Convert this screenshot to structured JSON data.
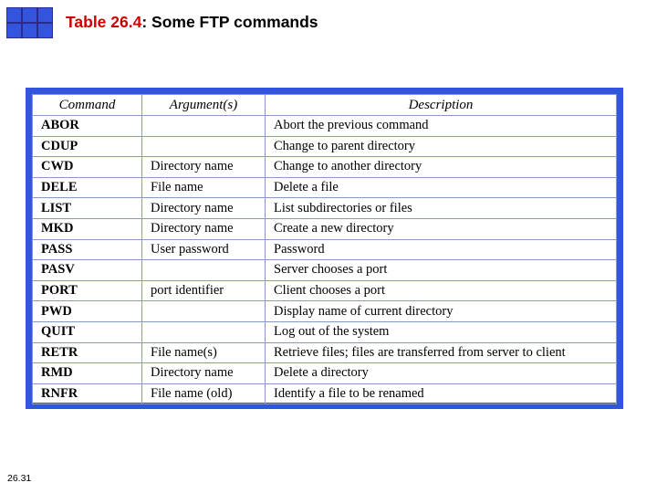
{
  "slide": {
    "title_number": "Table 26.4",
    "title_colon": ":",
    "title_text": " Some FTP commands",
    "page_number": "26.31",
    "accent_color": "#3355dd",
    "title_number_color": "#cc0000"
  },
  "table": {
    "headers": [
      "Command",
      "Argument(s)",
      "Description"
    ],
    "rows": [
      {
        "command": "ABOR",
        "argument": "",
        "description": "Abort the previous command"
      },
      {
        "command": "CDUP",
        "argument": "",
        "description": "Change to parent directory"
      },
      {
        "command": "CWD",
        "argument": "Directory name",
        "description": "Change to another directory"
      },
      {
        "command": "DELE",
        "argument": "File name",
        "description": "Delete a file"
      },
      {
        "command": "LIST",
        "argument": "Directory name",
        "description": "List subdirectories or files"
      },
      {
        "command": "MKD",
        "argument": "Directory name",
        "description": "Create a new directory"
      },
      {
        "command": "PASS",
        "argument": "User password",
        "description": "Password"
      },
      {
        "command": "PASV",
        "argument": "",
        "description": "Server chooses a port"
      },
      {
        "command": "PORT",
        "argument": "port identifier",
        "description": "Client chooses a port"
      },
      {
        "command": "PWD",
        "argument": "",
        "description": "Display name of current directory"
      },
      {
        "command": "QUIT",
        "argument": "",
        "description": "Log out of the system"
      },
      {
        "command": "RETR",
        "argument": "File name(s)",
        "description": "Retrieve files; files are transferred from server to client"
      },
      {
        "command": "RMD",
        "argument": "Directory name",
        "description": "Delete a directory"
      },
      {
        "command": "RNFR",
        "argument": "File name (old)",
        "description": "Identify a file to be renamed"
      }
    ]
  }
}
